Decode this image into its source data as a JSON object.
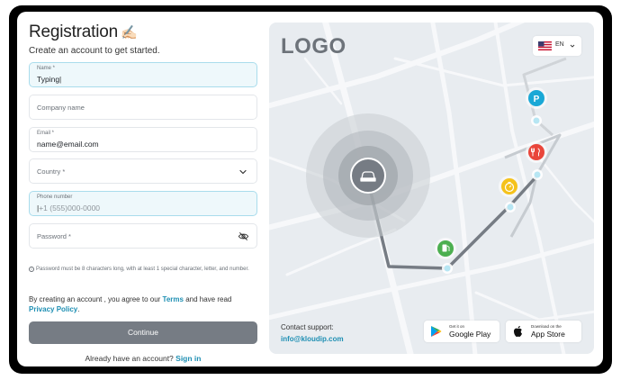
{
  "form": {
    "title": "Registration",
    "title_emoji": "✍🏻",
    "subtitle": "Create an account to get started.",
    "name": {
      "label": "Name *",
      "value": "Typing"
    },
    "company": {
      "placeholder": "Company name"
    },
    "email": {
      "label": "Email *",
      "value": "name@email.com"
    },
    "country": {
      "placeholder": "Country *"
    },
    "phone": {
      "label": "Phone number",
      "placeholder": "+1 (555)000-0000"
    },
    "password": {
      "placeholder": "Password *"
    },
    "password_hint": "Password must be 8 characters long, with at least 1 special character, letter, and number.",
    "terms_prefix": "By creating an account , you agree to our ",
    "terms_link": "Terms",
    "terms_middle": " and have read ",
    "privacy_link": "Privacy Policy",
    "terms_suffix": ".",
    "continue_label": "Continue",
    "signin_prefix": "Already have an account? ",
    "signin_link": "Sign in"
  },
  "panel": {
    "logo": "LOGO",
    "language": "EN",
    "support_label": "Contact support:",
    "support_email": "info@kloudip.com",
    "google_play": {
      "small": "Get it on",
      "big": "Google Play"
    },
    "app_store": {
      "small": "Download on the",
      "big": "App Store"
    }
  },
  "icons": {
    "parking": "P",
    "route_color": "#767c84",
    "accent": "#1e8fb3"
  }
}
